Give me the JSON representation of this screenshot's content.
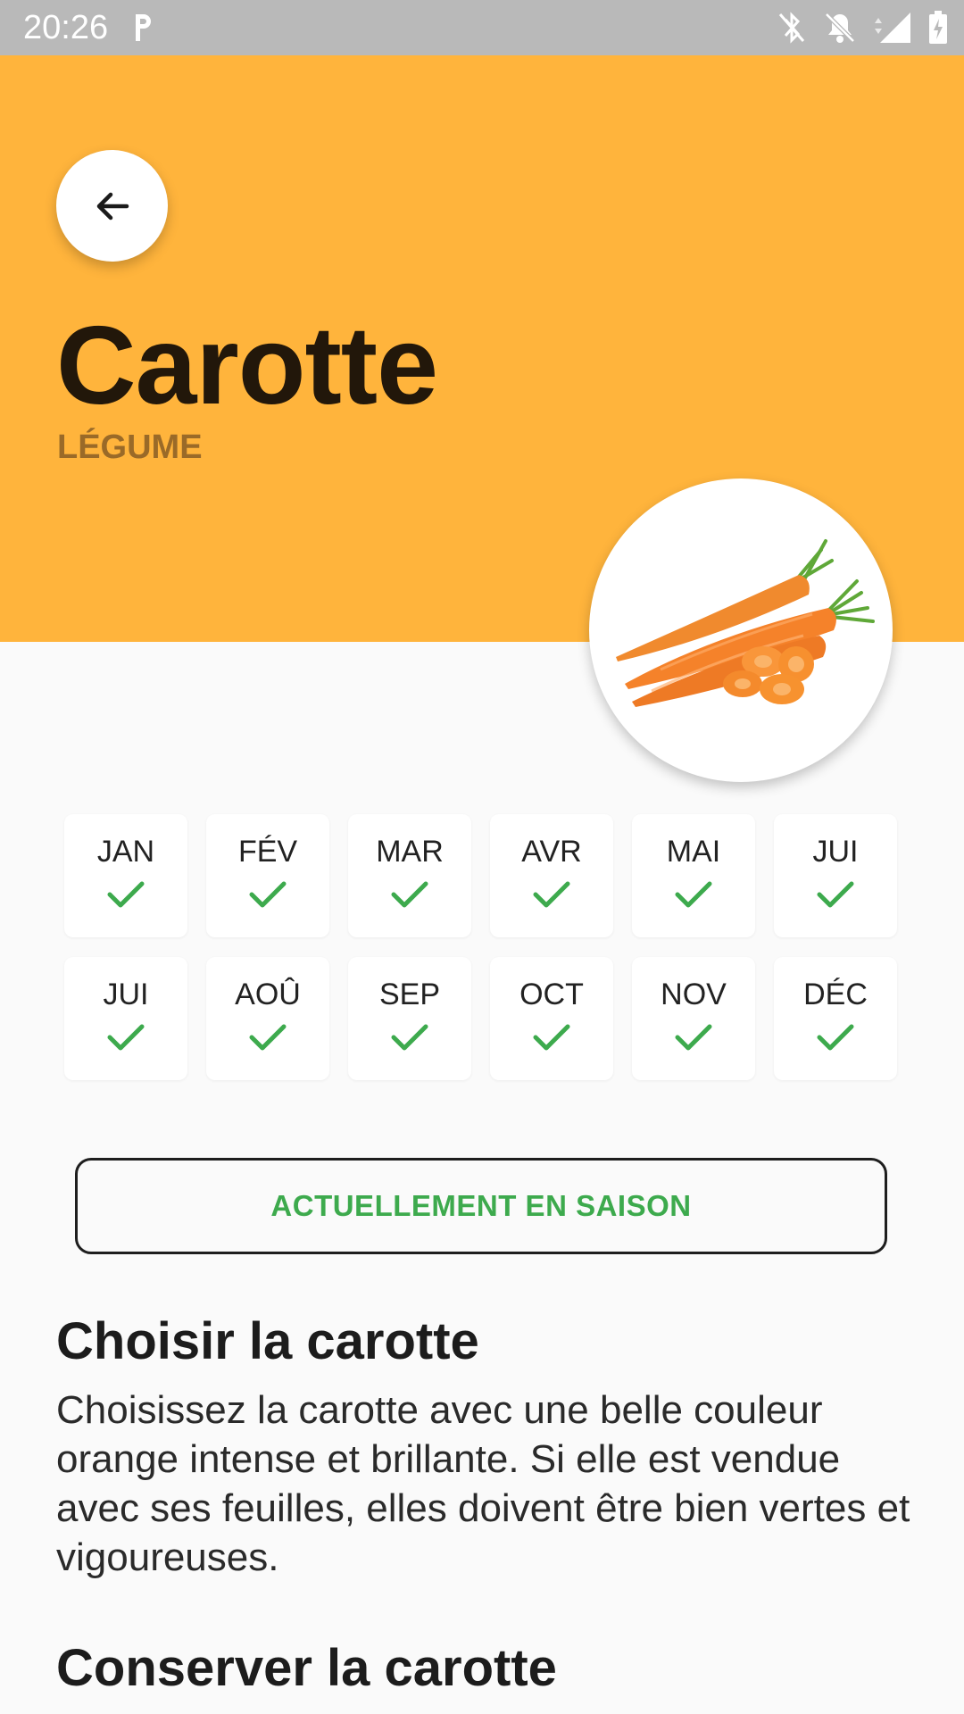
{
  "status_bar": {
    "time": "20:26"
  },
  "header": {
    "title": "Carotte",
    "category": "LÉGUME",
    "background_color": "#ffb43c"
  },
  "months": [
    {
      "label": "JAN",
      "in_season": true
    },
    {
      "label": "FÉV",
      "in_season": true
    },
    {
      "label": "MAR",
      "in_season": true
    },
    {
      "label": "AVR",
      "in_season": true
    },
    {
      "label": "MAI",
      "in_season": true
    },
    {
      "label": "JUI",
      "in_season": true
    },
    {
      "label": "JUI",
      "in_season": true
    },
    {
      "label": "AOÛ",
      "in_season": true
    },
    {
      "label": "SEP",
      "in_season": true
    },
    {
      "label": "OCT",
      "in_season": true
    },
    {
      "label": "NOV",
      "in_season": true
    },
    {
      "label": "DÉC",
      "in_season": true
    }
  ],
  "season_button": {
    "label": "ACTUELLEMENT EN SAISON",
    "color": "#3daa4d"
  },
  "sections": {
    "choose": {
      "title": "Choisir la carotte",
      "body": "Choisissez la carotte avec une belle couleur orange intense et brillante. Si elle est vendue avec ses feuilles, elles doivent être bien vertes et vigoureuses."
    },
    "store": {
      "title": "Conserver la carotte"
    }
  },
  "icons": {
    "back": "arrow-left-icon",
    "check": "checkmark-icon",
    "status": [
      "parking-app-icon",
      "bluetooth-icon",
      "notifications-off-icon",
      "signal-4g-icon",
      "battery-charging-icon"
    ]
  }
}
